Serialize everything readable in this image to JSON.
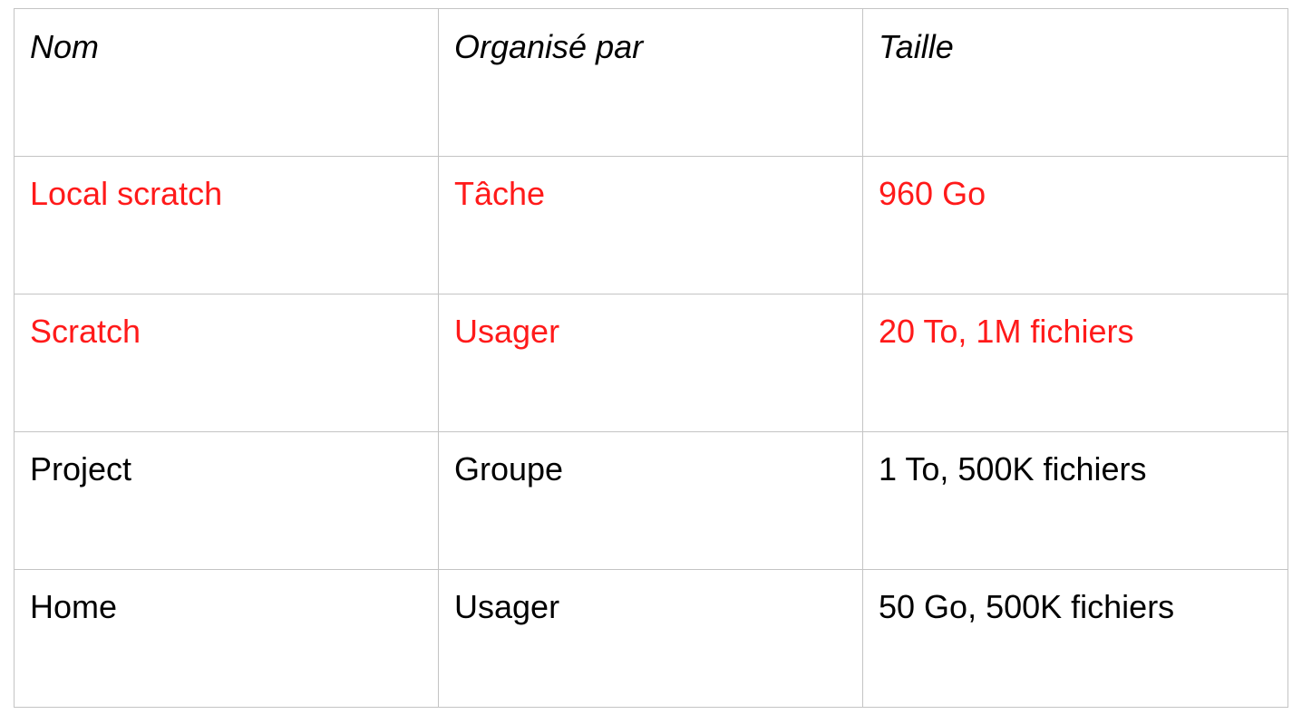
{
  "table": {
    "headers": [
      "Nom",
      "Organisé par",
      "Taille"
    ],
    "rows": [
      {
        "cells": [
          "Local scratch",
          "Tâche",
          "960 Go"
        ],
        "color": "#ff1a1a"
      },
      {
        "cells": [
          "Scratch",
          "Usager",
          "20 To,  1M fichiers"
        ],
        "color": "#ff1a1a"
      },
      {
        "cells": [
          "Project",
          "Groupe",
          "1 To,  500K fichiers"
        ],
        "color": "#000000"
      },
      {
        "cells": [
          "Home",
          "Usager",
          "50 Go, 500K fichiers"
        ],
        "color": "#000000"
      }
    ]
  }
}
